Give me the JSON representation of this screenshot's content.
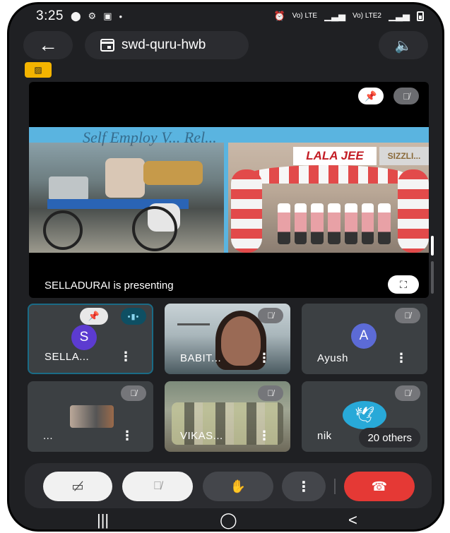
{
  "status_bar": {
    "time": "3:25",
    "net1": "Vo) LTE",
    "net2": "LTE1 ↓↑",
    "net3": "Vo) LTE2"
  },
  "header": {
    "meeting_code": "swd-quru-hwb"
  },
  "presentation": {
    "caption": "SELLADURAI is presenting",
    "slide_title": "Self Employ V... Rel...",
    "shop_sign": "LALA JEE",
    "shop_sign_2": "SIZZLI..."
  },
  "participants": [
    {
      "name": "SELLA...",
      "avatar_letter": "S",
      "avatar_color": "#5c3bd0"
    },
    {
      "name": "BABIT..."
    },
    {
      "name": "Ayush",
      "avatar_letter": "A",
      "avatar_color": "#5c6bd6"
    },
    {
      "name": "..."
    },
    {
      "name": "VIKAS..."
    },
    {
      "name": "nik"
    }
  ],
  "others_label": "20 others",
  "colors": {
    "end_call": "#e53935",
    "accent": "#1a6b86",
    "background": "#1f2023"
  }
}
